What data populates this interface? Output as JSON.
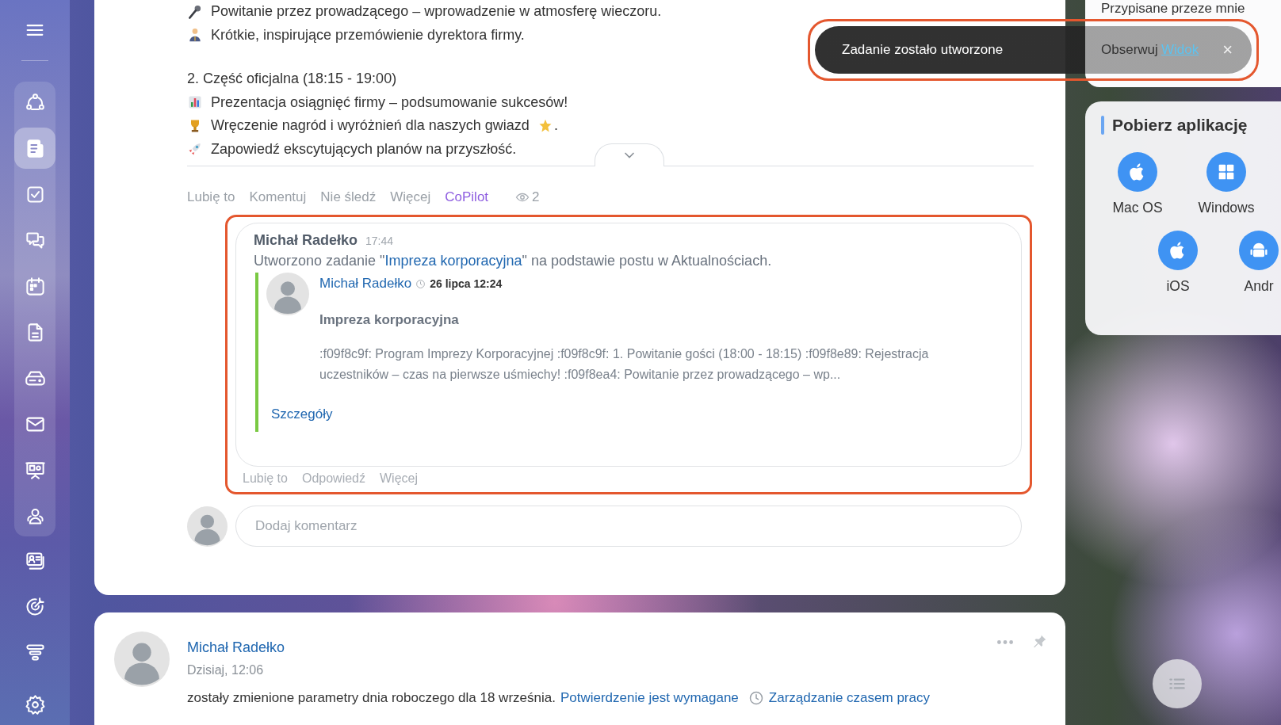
{
  "sidebar": {
    "pinned": [
      {
        "selected": false
      },
      {
        "selected": true
      },
      {
        "selected": false
      },
      {
        "selected": false
      },
      {
        "selected": false
      },
      {
        "selected": false
      },
      {
        "selected": false
      },
      {
        "selected": false
      },
      {
        "selected": false
      },
      {
        "selected": false
      }
    ],
    "more": [
      {
        "selected": false
      },
      {
        "selected": false
      },
      {
        "selected": false
      },
      {
        "selected": false
      }
    ]
  },
  "post": {
    "sections": [
      {
        "lines": [
          {
            "text": "Powitanie przez prowadzącego – wprowadzenie w atmosferę wieczoru."
          },
          {
            "text": "Krótkie, inspirujące przemówienie dyrektora firmy."
          }
        ]
      },
      {
        "lines": [
          {
            "text": "2. Część oficjalna (18:15 - 19:00)"
          },
          {
            "text": "Prezentacja osiągnięć firmy – podsumowanie sukcesów!"
          },
          {
            "text": "Wręczenie nagród i wyróżnień dla naszych gwiazd",
            "tail": "."
          },
          {
            "text": "Zapowiedź ekscytujących planów na przyszłość."
          }
        ]
      }
    ],
    "actions": [
      {
        "label": "Lubię to",
        "kind": "plain"
      },
      {
        "label": "Komentuj",
        "kind": "plain"
      },
      {
        "label": "Nie śledź",
        "kind": "plain"
      },
      {
        "label": "Więcej",
        "kind": "plain"
      },
      {
        "label": "CoPilot",
        "kind": "copilot"
      }
    ],
    "views": "2",
    "comment": {
      "author": "Michał Radełko",
      "time": "17:44",
      "text_before": "Utworzono zadanie \"",
      "link": "Impreza korporacyjna",
      "text_after": "\" na podstawie postu w Aktualnościach.",
      "quote": {
        "author": "Michał Radełko",
        "date": "26 lipca 12:24",
        "title": "Impreza korporacyjna",
        "body": ":f09f8c9f: Program Imprezy Korporacyjnej :f09f8c9f: 1. Powitanie gości (18:00 - 18:15) :f09f8e89: Rejestracja uczestników – czas na pierwsze uśmiechy! :f09f8ea4: Powitanie przez prowadzącego – wp...",
        "details": "Szczegóły"
      },
      "actions": [
        "Lubię to",
        "Odpowiedź",
        "Więcej"
      ]
    },
    "comment_input": {
      "placeholder": "Dodaj komentarz"
    }
  },
  "notice_post": {
    "author": "Michał Radełko",
    "date": "Dzisiaj, 12:06",
    "text": "zostały zmienione parametry dnia roboczego dla 18 września.",
    "link": "Potwierdzenie jest wymagane",
    "app_link": "Zarządzanie czasem pracy"
  },
  "tasks_widget": {
    "items": [
      "Przypisane przeze mnie",
      "Obserwuj"
    ]
  },
  "apps_widget": {
    "title": "Pobierz aplikację",
    "apps": [
      {
        "label": "Mac OS",
        "kind": "apple"
      },
      {
        "label": "Windows",
        "kind": "windows"
      },
      {
        "label": "iOS",
        "kind": "apple"
      },
      {
        "label": "Andr",
        "kind": "android"
      }
    ]
  },
  "toast": {
    "message": "Zadanie zostało utworzone",
    "action": "Widok",
    "close": "×"
  }
}
